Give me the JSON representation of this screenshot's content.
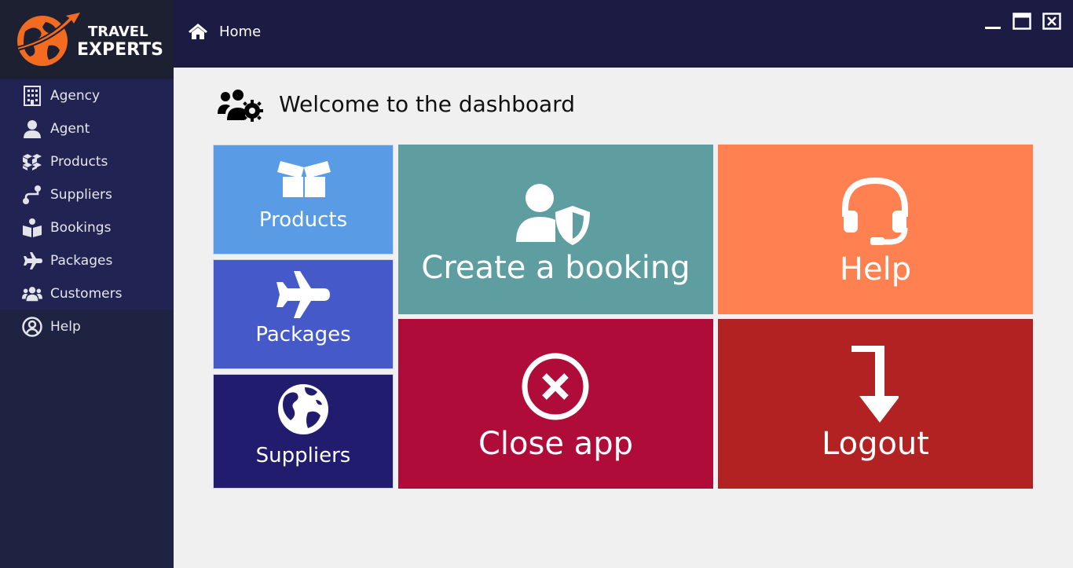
{
  "app": {
    "logo_line1": "TRAVEL",
    "logo_line2": "EXPERTS",
    "brand_color": "#f26b21"
  },
  "topbar": {
    "home_icon": "home-icon",
    "breadcrumb": "Home"
  },
  "sidebar": {
    "items": [
      {
        "label": "Agency",
        "icon": "building-icon"
      },
      {
        "label": "Agent",
        "icon": "user-icon"
      },
      {
        "label": "Products",
        "icon": "boxes-icon"
      },
      {
        "label": "Suppliers",
        "icon": "route-icon"
      },
      {
        "label": "Bookings",
        "icon": "book-reader-icon"
      },
      {
        "label": "Packages",
        "icon": "plane-icon"
      },
      {
        "label": "Customers",
        "icon": "users-icon"
      },
      {
        "label": "Help",
        "icon": "user-circle-icon"
      }
    ]
  },
  "main": {
    "welcome": "Welcome to the dashboard",
    "tiles": {
      "products": {
        "label": "Products",
        "color": "#5a9be6"
      },
      "packages": {
        "label": "Packages",
        "color": "#4559c9"
      },
      "suppliers": {
        "label": "Suppliers",
        "color": "#221c6e"
      },
      "create_booking": {
        "label": "Create a booking",
        "color": "#5f9ea0"
      },
      "help": {
        "label": "Help",
        "color": "#ff8050"
      },
      "close_app": {
        "label": "Close app",
        "color": "#b00c3a"
      },
      "logout": {
        "label": "Logout",
        "color": "#b22222"
      }
    }
  }
}
